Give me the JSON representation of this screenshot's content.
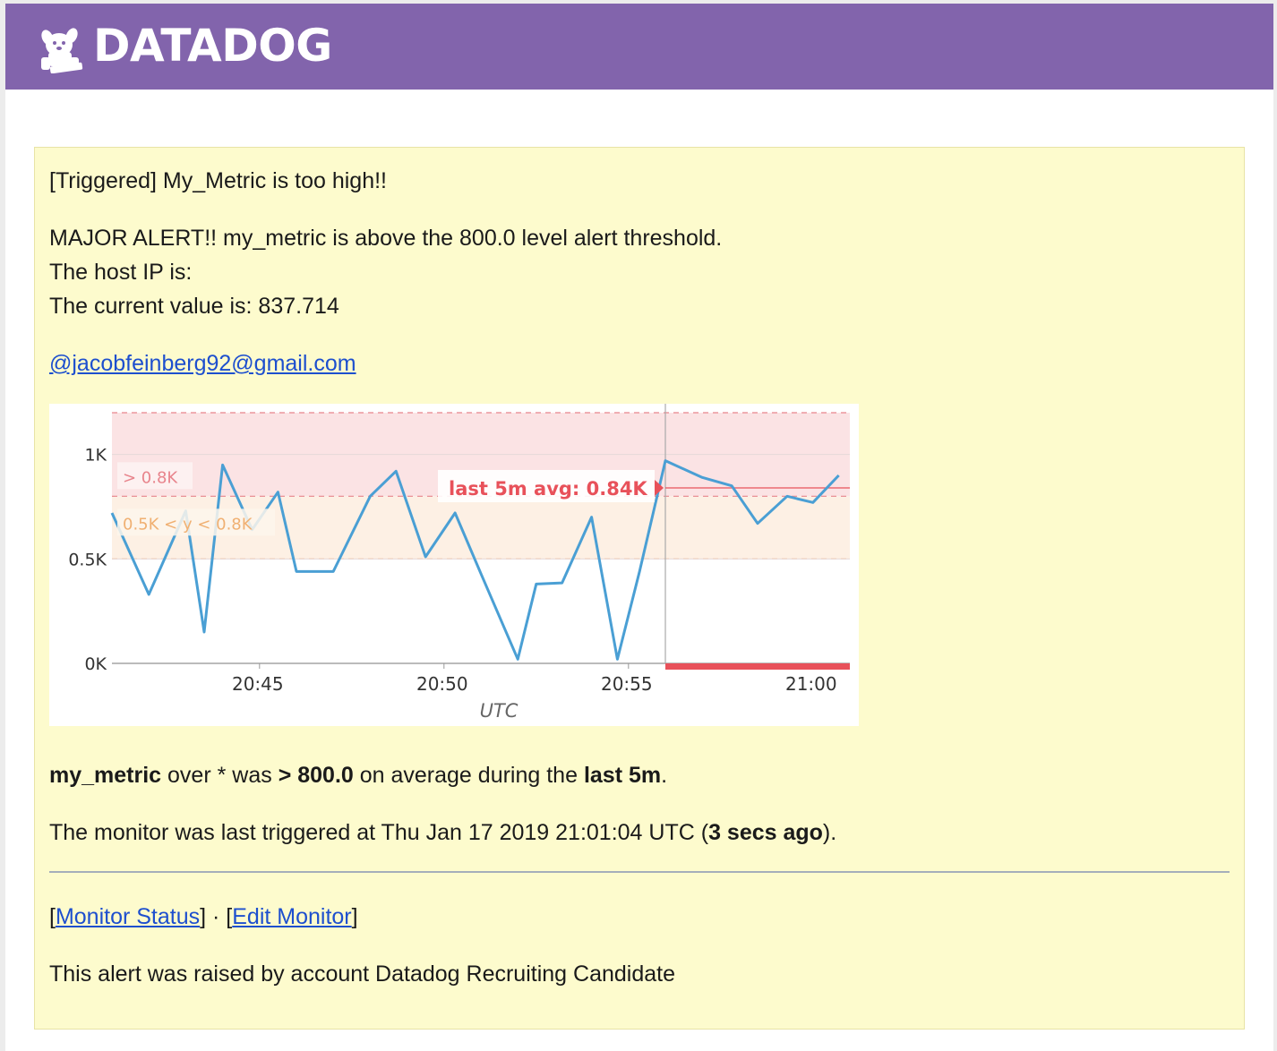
{
  "header": {
    "brand": "DATADOG"
  },
  "alert": {
    "title": "[Triggered] My_Metric is too high!!",
    "message_line1": "MAJOR ALERT!! my_metric is above the 800.0 level alert threshold.",
    "message_line2": "The host IP is:",
    "message_line3": "The current value is: 837.714",
    "mention": "@jacobfeinberg92@gmail.com",
    "summary": {
      "metric": "my_metric",
      "over": " over * was ",
      "condition": "> 800.0",
      "middle": " on average during the ",
      "window": "last 5m",
      "end": "."
    },
    "trigger": {
      "prefix": "The monitor was last triggered at Thu Jan 17 2019 21:01:04 UTC (",
      "ago": "3 secs ago",
      "suffix": ")."
    },
    "links": {
      "open_bracket_1": "[",
      "monitor_status": "Monitor Status",
      "close_sep": "] · [",
      "edit_monitor": "Edit Monitor",
      "close_bracket_2": "]"
    },
    "footer": "This alert was raised by account Datadog Recruiting Candidate"
  },
  "chart_data": {
    "type": "line",
    "xlabel": "UTC",
    "x_ticks": [
      "20:45",
      "20:50",
      "20:55",
      "21:00"
    ],
    "y_ticks": [
      "0K",
      "0.5K",
      "1K"
    ],
    "ylim": [
      0,
      1200
    ],
    "x_start": "20:41",
    "x_end": "21:01",
    "threshold_labels": {
      "alert": "> 0.8K",
      "warning": "0.5K < y < 0.8K",
      "avg": "last 5m avg: 0.84K"
    },
    "thresholds": {
      "alert": 800,
      "warning": 500
    },
    "colors": {
      "line": "#4a9fd4",
      "alert": "#e8848c",
      "warning": "#f4c9a0",
      "avg": "#e8515a"
    },
    "series": [
      {
        "values": [
          [
            "20:41",
            720
          ],
          [
            "20:42",
            330
          ],
          [
            "20:43",
            730
          ],
          [
            "20:43.5",
            150
          ],
          [
            "20:44",
            950
          ],
          [
            "20:44.8",
            640
          ],
          [
            "20:45.5",
            820
          ],
          [
            "20:46",
            440
          ],
          [
            "20:47",
            440
          ],
          [
            "20:48",
            800
          ],
          [
            "20:48.7",
            920
          ],
          [
            "20:49.5",
            510
          ],
          [
            "20:50.3",
            720
          ],
          [
            "20:51",
            430
          ],
          [
            "20:52",
            20
          ],
          [
            "20:52.5",
            380
          ],
          [
            "20:53.2",
            385
          ],
          [
            "20:54",
            700
          ],
          [
            "20:54.7",
            20
          ],
          [
            "20:55.3",
            440
          ],
          [
            "20:56",
            970
          ],
          [
            "20:57",
            890
          ],
          [
            "20:57.8",
            850
          ],
          [
            "20:58.5",
            670
          ],
          [
            "20:59.3",
            800
          ],
          [
            "21:00",
            770
          ],
          [
            "21:00.7",
            900
          ]
        ]
      }
    ],
    "last_5m_avg": 840
  }
}
